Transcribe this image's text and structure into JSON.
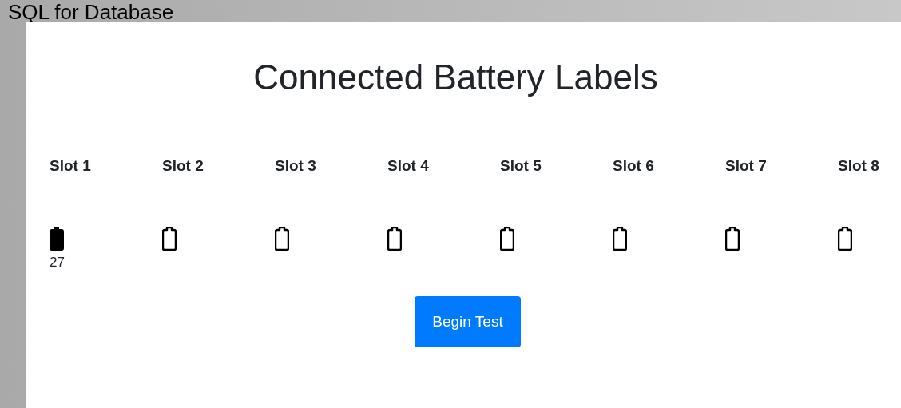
{
  "page_heading": "SQL for Database",
  "title": "Connected Battery Labels",
  "slots": [
    {
      "label": "Slot 1",
      "filled": true,
      "reading": "27"
    },
    {
      "label": "Slot 2",
      "filled": false
    },
    {
      "label": "Slot 3",
      "filled": false
    },
    {
      "label": "Slot 4",
      "filled": false
    },
    {
      "label": "Slot 5",
      "filled": false
    },
    {
      "label": "Slot 6",
      "filled": false
    },
    {
      "label": "Slot 7",
      "filled": false
    },
    {
      "label": "Slot 8",
      "filled": false
    }
  ],
  "button": "Begin Test"
}
